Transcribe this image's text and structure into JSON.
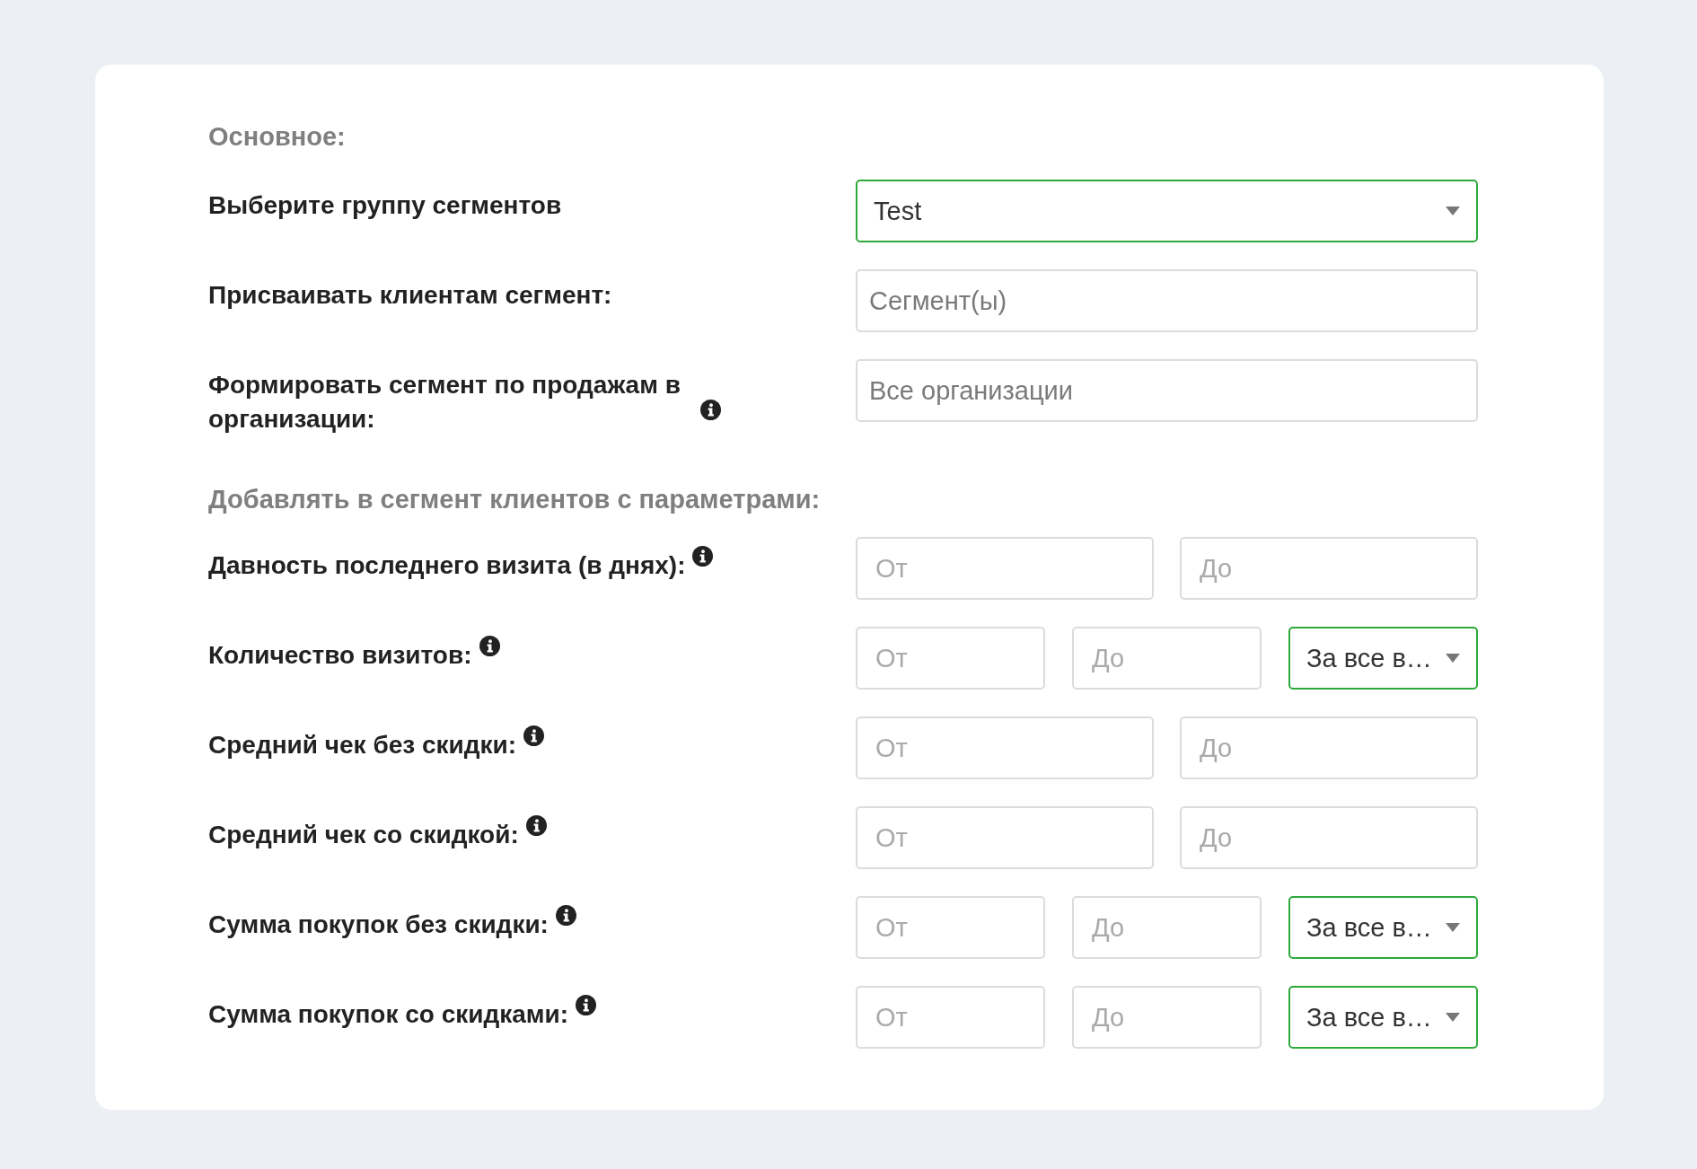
{
  "sections": [
    {
      "heading": "Основное:",
      "rows": [
        {
          "kind": "select",
          "label": "Выберите группу сегментов",
          "info": false,
          "value": "Test"
        },
        {
          "kind": "input",
          "label": "Присваивать клиентам сегмент:",
          "info": false,
          "placeholder": "Сегмент(ы)"
        },
        {
          "kind": "input",
          "label": "Формировать сегмент по продажам в организации:",
          "info": true,
          "placeholder": "Все организации"
        }
      ]
    },
    {
      "heading": "Добавлять в сегмент клиентов с параметрами:",
      "rows": [
        {
          "kind": "range",
          "label": "Давность последнего визита (в днях):",
          "info": true,
          "from": {
            "placeholder": "От"
          },
          "to": {
            "placeholder": "До"
          }
        },
        {
          "kind": "range",
          "label": "Количество визитов:",
          "info": true,
          "from": {
            "placeholder": "От"
          },
          "to": {
            "placeholder": "До"
          },
          "period": {
            "value": "За все в…"
          }
        },
        {
          "kind": "range",
          "label": "Средний чек без скидки:",
          "info": true,
          "from": {
            "placeholder": "От"
          },
          "to": {
            "placeholder": "До"
          }
        },
        {
          "kind": "range",
          "label": "Средний чек со скидкой:",
          "info": true,
          "from": {
            "placeholder": "От"
          },
          "to": {
            "placeholder": "До"
          }
        },
        {
          "kind": "range",
          "label": "Сумма покупок без скидки:",
          "info": true,
          "from": {
            "placeholder": "От"
          },
          "to": {
            "placeholder": "До"
          },
          "period": {
            "value": "За все в…"
          }
        },
        {
          "kind": "range",
          "label": "Сумма покупок со скидками:",
          "info": true,
          "from": {
            "placeholder": "От"
          },
          "to": {
            "placeholder": "До"
          },
          "period": {
            "value": "За все в…"
          }
        }
      ]
    }
  ]
}
